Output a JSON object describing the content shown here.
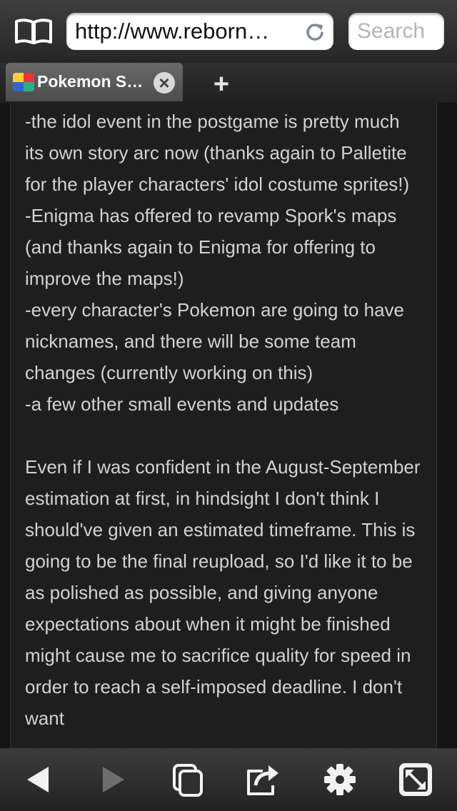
{
  "topbar": {
    "url": "http://www.reborn…",
    "search_placeholder": "Search"
  },
  "tabs": {
    "active_title": "Pokemon S…",
    "close_label": "×",
    "new_tab_label": "+"
  },
  "post": {
    "paragraphs": [
      "-the idol event in the postgame is pretty much its own story arc now (thanks again to Palletite for the player characters' idol costume sprites!)",
      "-Enigma has offered to revamp Spork's maps (and thanks again to Enigma for offering to improve the maps!)",
      "-every character's Pokemon are going to have nicknames, and there will be some team changes (currently working on this)",
      "-a few other small events and updates",
      "Even if I was confident in the August-September estimation at first, in hindsight I don't think I should've given an estimated timeframe. This is going to be the final reupload, so I'd like it to be as polished as possible, and giving anyone expectations about when it might be finished might cause me to sacrifice quality for speed in order to reach a self-imposed deadline. I don't want"
    ]
  },
  "toolbar": {
    "icons": [
      "back-icon",
      "forward-icon",
      "tabs-icon",
      "share-icon",
      "settings-icon",
      "fullscreen-icon"
    ]
  },
  "colors": {
    "content_bg": "#1e1e1e",
    "text": "#d2d2d2",
    "chrome": "#2e2e2e"
  }
}
